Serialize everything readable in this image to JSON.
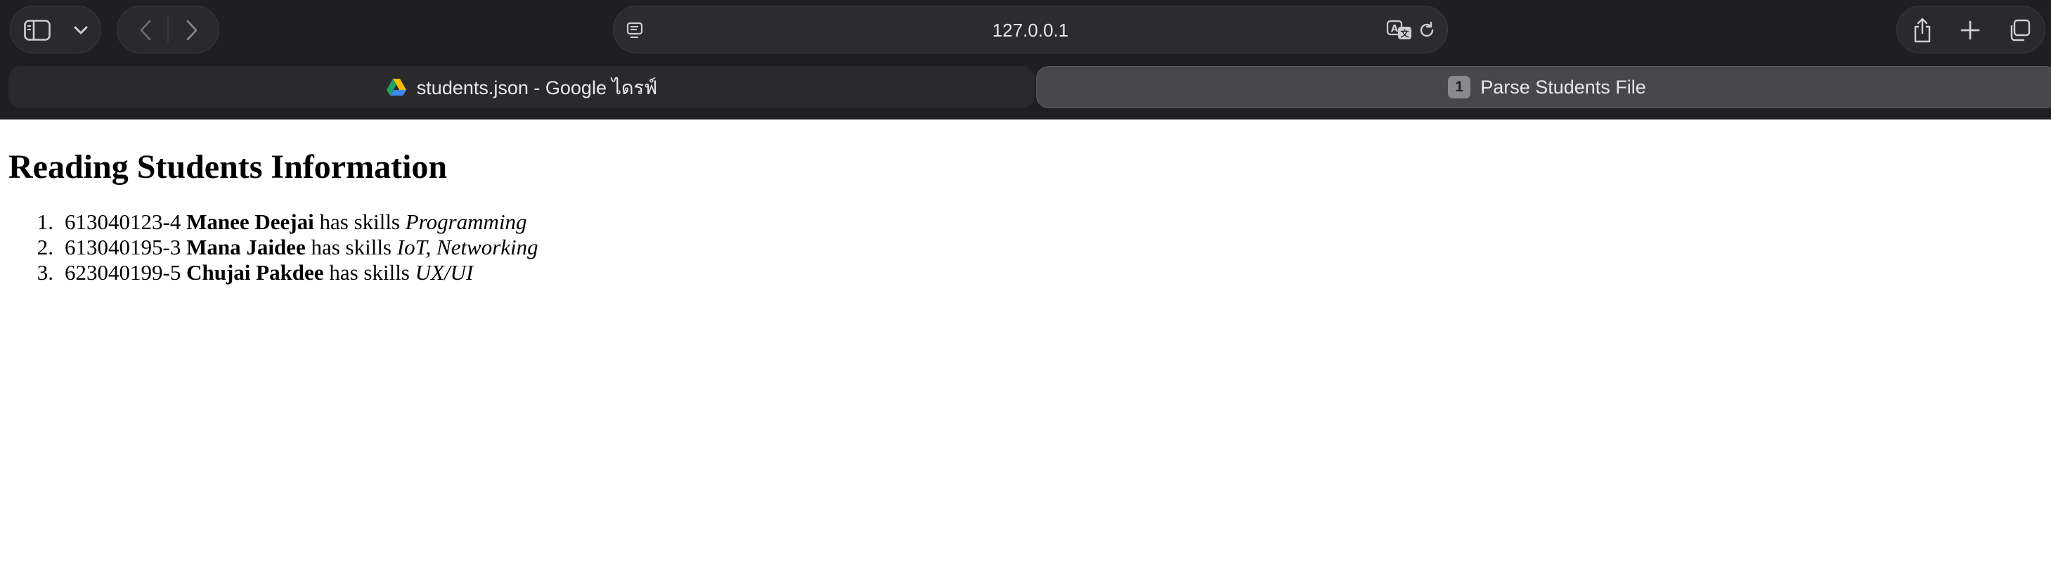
{
  "browser": {
    "address": "127.0.0.1",
    "tabs": [
      {
        "label": "students.json - Google ไดรฟ์",
        "active": false,
        "icon": "google-drive-icon"
      },
      {
        "label": "Parse Students File",
        "active": true,
        "badge": "1"
      }
    ],
    "colors": {
      "chrome_bg": "#1f1f22",
      "active_tab": "#48484c",
      "text": "#e8e8ea"
    }
  },
  "page": {
    "title": "Reading Students Information",
    "students": [
      {
        "number": "1.",
        "id": "613040123-4",
        "name": "Manee Deejai",
        "connector": "has skills",
        "skills": "Programming"
      },
      {
        "number": "2.",
        "id": "613040195-3",
        "name": "Mana Jaidee",
        "connector": "has skills",
        "skills": "IoT, Networking"
      },
      {
        "number": "3.",
        "id": "623040199-5",
        "name": "Chujai Pakdee",
        "connector": "has skills",
        "skills": "UX/UI"
      }
    ]
  }
}
